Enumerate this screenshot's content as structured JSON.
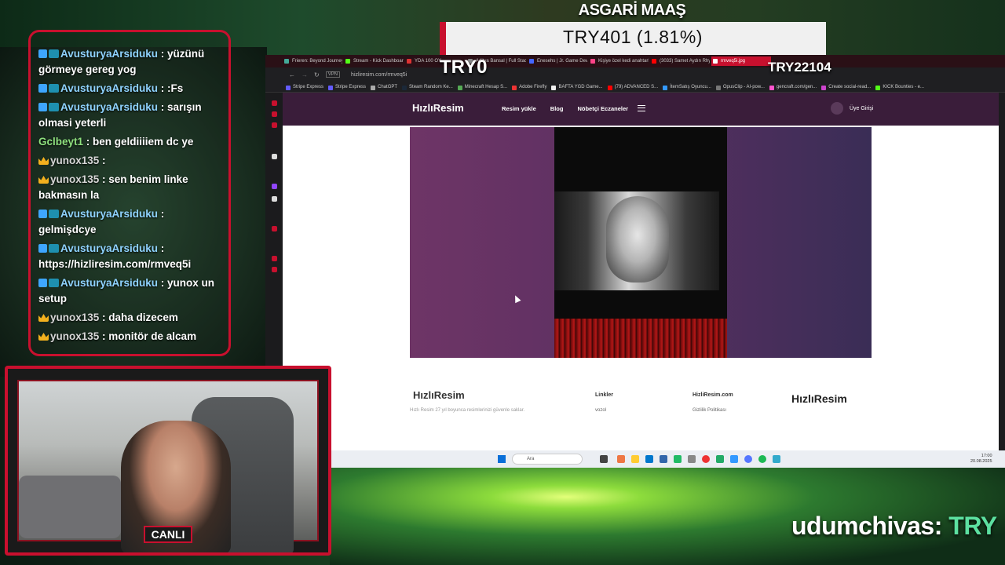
{
  "overlay": {
    "asgari_title": "ASGARİ MAAŞ",
    "price": "TRY401 (1.81%)",
    "try_left": "TRY0",
    "try_right": "TRY22104",
    "ticker_user": "udumchivas:",
    "ticker_value": "TRY",
    "live_label": "CANLI"
  },
  "chat": [
    {
      "user": "AvusturyaArsiduku",
      "text": ": yüzünü görmeye gereg yog",
      "badges": [
        "sub",
        "mod"
      ],
      "color": "blue"
    },
    {
      "user": "AvusturyaArsiduku",
      "text": ": :Fs",
      "badges": [
        "sub",
        "mod"
      ],
      "color": "blue"
    },
    {
      "user": "AvusturyaArsiduku",
      "text": ": sarışın olmasi yeterli",
      "badges": [
        "sub",
        "mod"
      ],
      "color": "blue"
    },
    {
      "user": "Gclbeyt1",
      "text": ": ben geldiiiiem dc ye",
      "badges": [],
      "color": "green"
    },
    {
      "user": "yunox135",
      "text": ":",
      "badges": [
        "crown"
      ],
      "color": "yellow"
    },
    {
      "user": "yunox135",
      "text": ": sen benim linke bakmasın la",
      "badges": [
        "crown"
      ],
      "color": "yellow"
    },
    {
      "user": "AvusturyaArsiduku",
      "text": ": gelmişdcye",
      "badges": [
        "sub",
        "mod"
      ],
      "color": "blue"
    },
    {
      "user": "AvusturyaArsiduku",
      "text": ": https://hizliresim.com/rmveq5i",
      "badges": [
        "sub",
        "mod"
      ],
      "color": "blue"
    },
    {
      "user": "AvusturyaArsiduku",
      "text": ": yunox un setup",
      "badges": [
        "sub",
        "mod"
      ],
      "color": "blue"
    },
    {
      "user": "yunox135",
      "text": ": daha dizecem",
      "badges": [
        "crown"
      ],
      "color": "yellow"
    },
    {
      "user": "yunox135",
      "text": ": monitör de alcam",
      "badges": [
        "crown"
      ],
      "color": "yellow"
    }
  ],
  "browser": {
    "tabs": [
      {
        "label": "Frieren: Beyond Journey's",
        "color": "#4a9"
      },
      {
        "label": "Stream - Kick Dashboard",
        "color": "#53fc18"
      },
      {
        "label": "YDA 100 OY",
        "color": "#d33"
      },
      {
        "label": "Aditya Bansal | Full Stack",
        "color": "#888"
      },
      {
        "label": "Enesehs | Jr. Game Dev",
        "color": "#46f"
      },
      {
        "label": "Kişiye özel kedi anahtarlı",
        "color": "#f48"
      },
      {
        "label": "(3033) Samet Aydın Rhy",
        "color": "#f00"
      },
      {
        "label": "rmveq5i.jpg",
        "color": "#fff"
      }
    ],
    "url": "hizliresim.com/rmveq5i",
    "bookmarks": [
      {
        "label": "Stripe Express",
        "color": "#635bff"
      },
      {
        "label": "Stripe Express",
        "color": "#635bff"
      },
      {
        "label": "ChatGPT",
        "color": "#aaa"
      },
      {
        "label": "Steam Random Ke...",
        "color": "#1b2838"
      },
      {
        "label": "Minecraft Hesap S...",
        "color": "#5a5"
      },
      {
        "label": "Adobe Firefly",
        "color": "#e33"
      },
      {
        "label": "BAFTA YGD Game...",
        "color": "#eee"
      },
      {
        "label": "(79) ADVANCED S...",
        "color": "#f00"
      },
      {
        "label": "İtemSatış Oyuncu...",
        "color": "#39f"
      },
      {
        "label": "OpusClip - AI-pow...",
        "color": "#777"
      },
      {
        "label": "gencraft.com/gen...",
        "color": "#f5c"
      },
      {
        "label": "Create social-read...",
        "color": "#c4c"
      },
      {
        "label": "KICK Bounties - e...",
        "color": "#53fc18"
      }
    ]
  },
  "site": {
    "logo": "HızlıResim",
    "nav": [
      "Resim yükle",
      "Blog",
      "Nöbetçi Eczaneler"
    ],
    "login": "Üye Girişi",
    "footer_desc": "Hızlı Resim 27 yıl boyunca resimlerinizi güvenle saklar.",
    "footer_links_title": "Linkler",
    "footer_link": "vozol",
    "footer_site_title": "HizliResim.com",
    "footer_site_link": "Gizlilik Politikası"
  },
  "taskbar": {
    "search_placeholder": "Ara",
    "time": "17:00",
    "date": "20.08.2025"
  },
  "colors": {
    "brand_red": "#c8102e",
    "site_header": "#3a1d3a"
  }
}
